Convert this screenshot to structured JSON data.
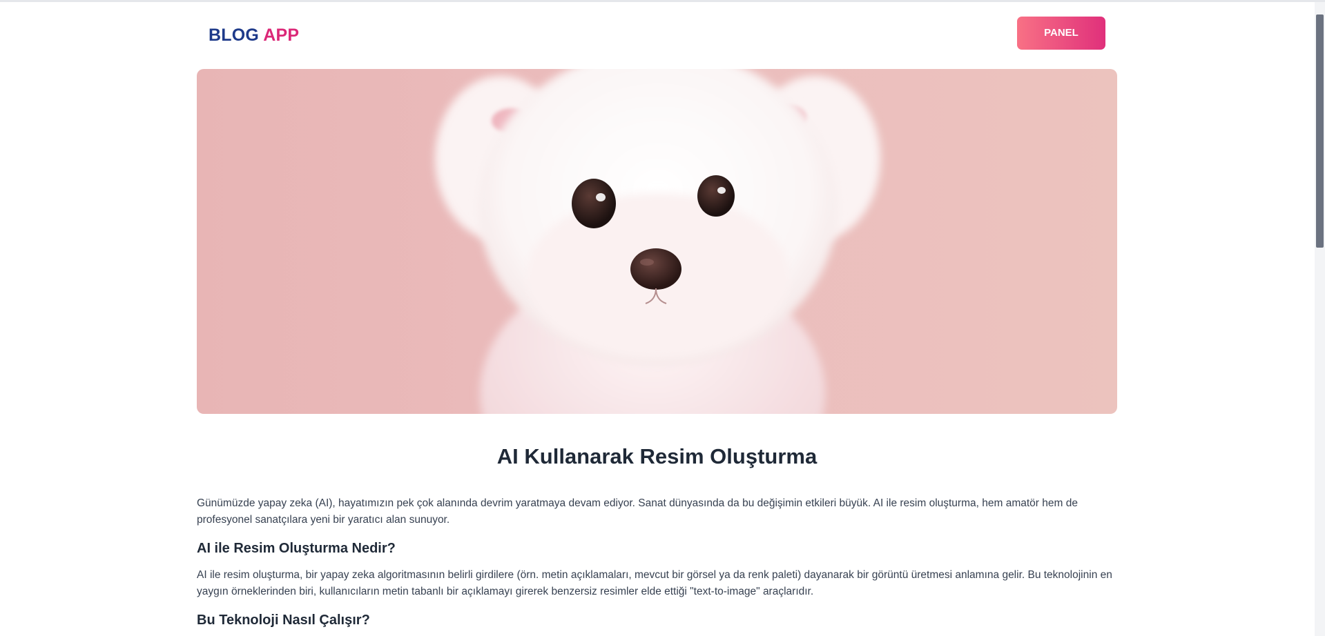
{
  "header": {
    "logo_part1": "BLOG",
    "logo_part2": "APP",
    "panel_label": "PANEL"
  },
  "hero": {
    "image": "white-puppy-on-pink-background"
  },
  "article": {
    "title": "AI Kullanarak Resim Oluşturma",
    "intro": "Günümüzde yapay zeka (AI), hayatımızın pek çok alanında devrim yaratmaya devam ediyor. Sanat dünyasında da bu değişimin etkileri büyük. AI ile resim oluşturma, hem amatör hem de profesyonel sanatçılara yeni bir yaratıcı alan sunuyor.",
    "section1_heading": "AI ile Resim Oluşturma Nedir?",
    "section1_text": "AI ile resim oluşturma, bir yapay zeka algoritmasının belirli girdilere (örn. metin açıklamaları, mevcut bir görsel ya da renk paleti) dayanarak bir görüntü üretmesi anlamına gelir. Bu teknolojinin en yaygın örneklerinden biri, kullanıcıların metin tabanlı bir açıklamayı girerek benzersiz resimler elde ettiği \"text-to-image\" araçlarıdır.",
    "section2_heading": "Bu Teknoloji Nasıl Çalışır?"
  },
  "colors": {
    "logo_blue": "#1e3a8a",
    "logo_pink": "#db2777",
    "button_gradient_start": "#f87185",
    "button_gradient_end": "#e0307b"
  }
}
